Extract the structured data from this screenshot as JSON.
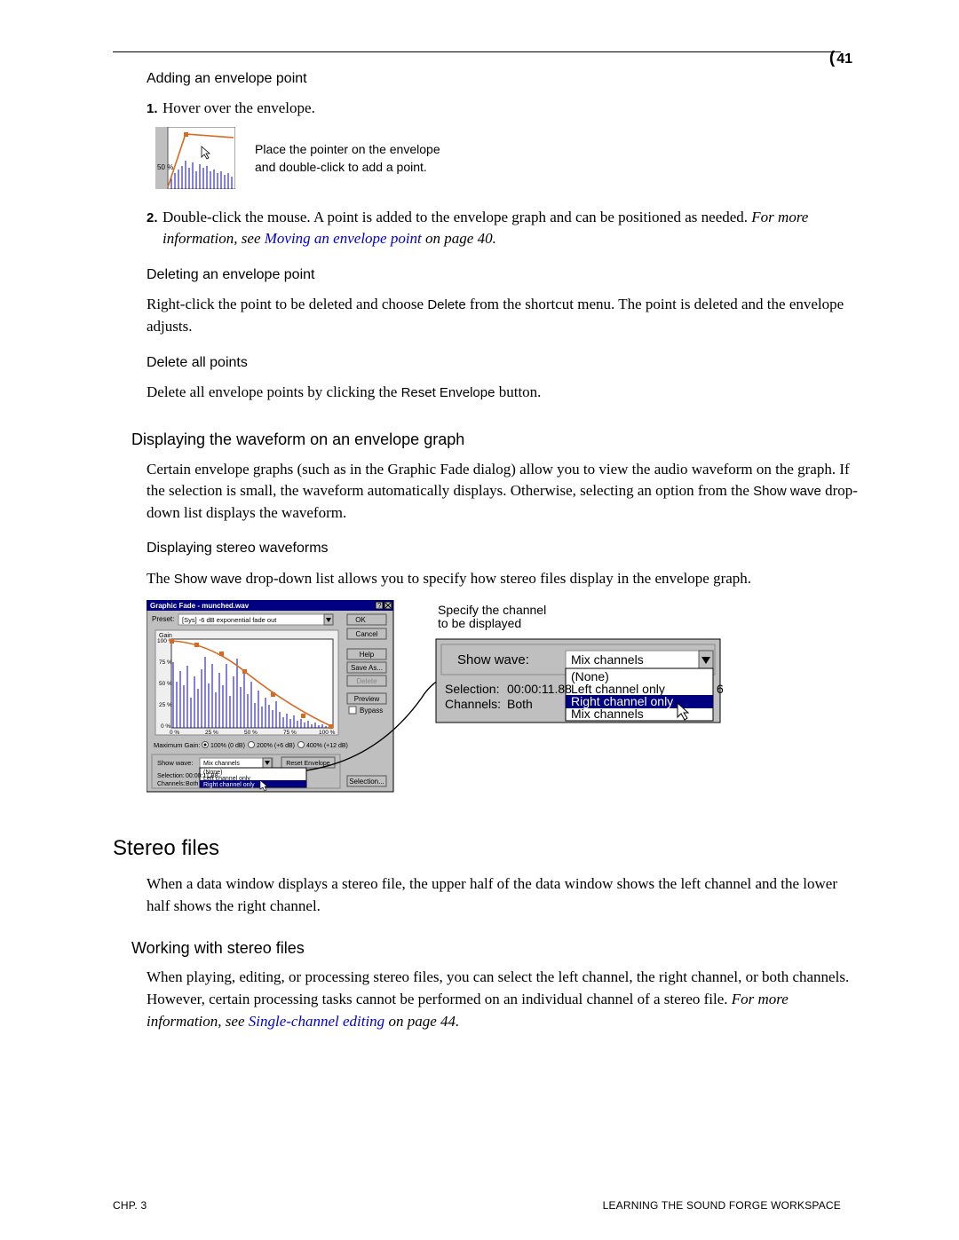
{
  "pageNumber": "41",
  "sections": {
    "addEnvPoint": "Adding an envelope point",
    "step1": "Hover over the envelope.",
    "envCaption1": "Place the pointer on the envelope",
    "envCaption2": "and double-click to add a point.",
    "step2a": "Double-click the mouse. A point is added to the envelope graph and can be positioned as needed. ",
    "step2_moreInfo": "For more information, see ",
    "step2_link": "Moving an envelope point",
    "step2_onPage": " on page 40",
    "delEnvPoint": "Deleting an envelope point",
    "delEnvText1": "Right-click the point to be deleted and choose ",
    "delEnvTerm": "Delete",
    "delEnvText2": " from the shortcut menu. The point is deleted and the envelope adjusts.",
    "delAll": "Delete all points",
    "delAllText1": "Delete all envelope points by clicking the ",
    "delAllTerm": "Reset Envelope",
    "delAllText2": " button.",
    "dispWave": "Displaying the waveform on an envelope graph",
    "dispWaveText1": "Certain envelope graphs (such as in the Graphic Fade dialog) allow you to view the audio waveform on the graph. If the selection is small, the waveform automatically displays. Otherwise, selecting an option from the ",
    "showWaveTerm": "Show wave",
    "dispWaveText2": " drop-down list displays the waveform.",
    "dispStereo": "Displaying stereo waveforms",
    "dispStereoText1": "The ",
    "dispStereoText2": " drop-down list allows you to specify how stereo files display in the envelope graph.",
    "specifyLabel1": "Specify the channel",
    "specifyLabel2": "to be displayed",
    "dialog": {
      "title": "Graphic Fade - munched.wav",
      "presetLabel": "Preset:",
      "presetValue": "[Sys] -6 dB exponential fade out",
      "gainLabel": "Gain",
      "y100": "100 %",
      "y75": "75 %",
      "y50": "50 %",
      "y25": "25 %",
      "y0": "0 %",
      "x0": "0 %",
      "x25": "25 %",
      "x50": "50 %",
      "x75": "75 %",
      "x100": "100 %",
      "maxGain": "Maximum Gain:",
      "g100": "100% (0 dB)",
      "g200": "200% (+6 dB)",
      "g400": "400% (+12 dB)",
      "showWave": "Show wave:",
      "showWaveVal": "Mix channels",
      "resetEnv": "Reset Envelope",
      "selectionLabel": "Selection:",
      "selectionVal": "00:00:11.88",
      "channelsLabel": "Channels:",
      "channelsVal": "Both",
      "opt1": "(None)",
      "opt2": "Left channel only",
      "opt3": "Right channel only",
      "opt4": "Mix channels",
      "ok": "OK",
      "cancel": "Cancel",
      "help": "Help",
      "saveAs": "Save As...",
      "delete": "Delete",
      "preview": "Preview",
      "bypass": "Bypass",
      "selectionBtn": "Selection..."
    },
    "zoom": {
      "showWave": "Show wave:",
      "mix": "Mix channels",
      "selection": "Selection:",
      "selTime": "00:00:11.88",
      "channels": "Channels:",
      "both": "Both",
      "none": "(None)",
      "left": "Left channel only",
      "right": "Right channel only",
      "mix2": "Mix channels",
      "six": "6"
    },
    "stereo": "Stereo files",
    "stereoText": "When a data window displays a stereo file, the upper half of the data window shows the left channel and the lower half shows the right channel.",
    "workStereo": "Working with stereo files",
    "workStereoText1": "When playing, editing, or processing stereo files, you can select the left channel, the right channel, or both channels. However, certain processing tasks cannot be performed on an individual channel of a stereo file. ",
    "workStereoMore": "For more information, see ",
    "workStereoLink": "Single-channel editing",
    "workStereoPage": " on page 44"
  },
  "footer": {
    "left": "CHP. 3",
    "right": "LEARNING THE SOUND FORGE WORKSPACE"
  }
}
